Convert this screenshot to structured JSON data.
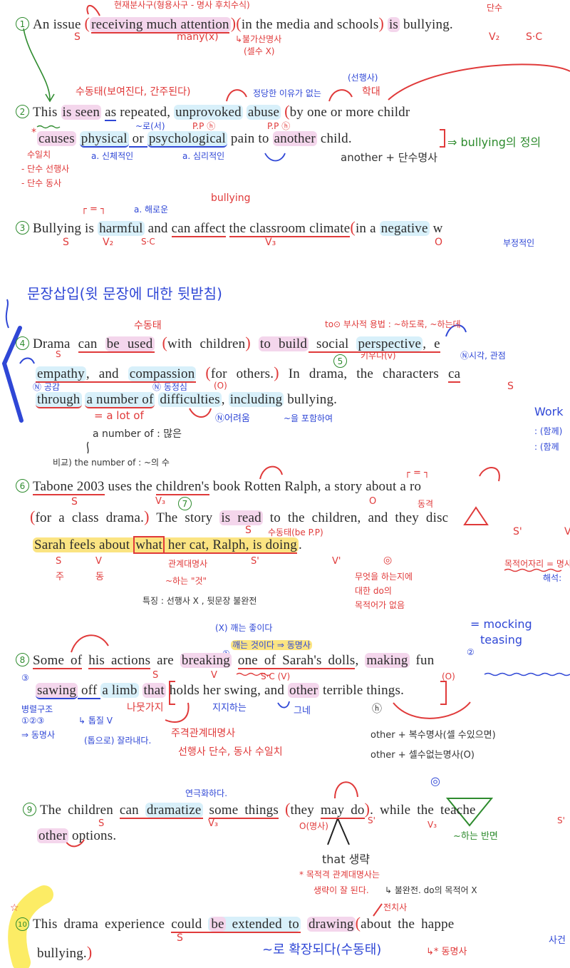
{
  "s1": {
    "num": "1",
    "t1": "An issue ",
    "t2": "receiving much attention",
    "t3": "in the media and schools",
    "t4": "is",
    "t5": " bullying.",
    "notes": {
      "top": "현재분사구(형용사구 - 명사 후치수식)",
      "s": "S",
      "many": "many(x)",
      "uncount": "↳불가산명사",
      "uncount2": "(셀수 X)",
      "sing": "단수",
      "v2": "V₂",
      "sc": "S·C"
    }
  },
  "s2": {
    "num": "2",
    "l1": {
      "t1": "This",
      "t2": "is seen",
      "t3": "as",
      "t4": " repeated, ",
      "t5": "unprovoked",
      "t6": "abuse",
      "t7": "by one or more childr"
    },
    "l2": {
      "t1": "causes",
      "t2": "physical",
      "t3": " or ",
      "t4": "psychological",
      "t5": " pain to ",
      "t6": "another",
      "t7": " child."
    },
    "notes": {
      "passive": "수동태(보여진다, 간주된다)",
      "unjust": "정당한 이유가 없는",
      "antecedent": "(선행사)",
      "abuse": "학대",
      "as": "~로(서)",
      "pp1": "P.P ⓗ",
      "pp2": "P.P ⓗ",
      "phys": "a. 신체적인",
      "psych": "a. 심리적인",
      "another": "another + 단수명사",
      "agree": "수일치",
      "sing_ante": "- 단수 선행사",
      "sing_verb": "- 단수 동사",
      "def": "⇒ bullying의 정의",
      "star": "*"
    }
  },
  "s3": {
    "num": "3",
    "t1": "Bullying",
    "t2": " is ",
    "t3": "harmful",
    "t4": " and ",
    "t5": "can affect",
    "t6": "the classroom climate",
    "t7": "in a ",
    "t8": "negative",
    "t9": " w",
    "notes": {
      "harmful": "a. 해로운",
      "eq": "┌ = ┐",
      "bullying": "bullying",
      "s": "S",
      "v2": "V₂",
      "sc": "S·C",
      "v3": "V₃",
      "o": "O",
      "negative": "부정적인"
    }
  },
  "section_heading": "문장삽입(윗 문장에 대한 뒷받침)",
  "s4": {
    "num": "4",
    "l1": {
      "t1": "Drama ",
      "t2": "can ",
      "t3": "be used",
      "t4": "with children",
      "t5": "to build",
      "t6": " social ",
      "t7": "perspective",
      "t8": ", e"
    },
    "l2": {
      "t1": "empathy",
      "t2": ", and ",
      "t3": "compassion",
      "t4": "for others.",
      "t5": " In drama, the characters ",
      "t6": "ca"
    },
    "l3": {
      "t1": "through",
      "t2": "a number of",
      "t3": "difficulties",
      "t4": ", ",
      "t5": "including",
      "t6": " bullying."
    },
    "notes": {
      "passive": "수동태",
      "to_v": "to⊙ 부사적 용법 : ~하도록, ~하는데",
      "build": "키우다(v)",
      "persp": "Ⓝ시각, 관점",
      "s": "S",
      "empathy": "Ⓝ 공감",
      "compassion": "Ⓝ 동정심",
      "o": "(O)",
      "s2": "S",
      "lot": "= a lot of",
      "diff": "Ⓝ어려움",
      "incl": "~을 포함하여",
      "anum": "a number of : 많은",
      "cmp": "비교) the number of : ~의 수",
      "num5": "5"
    },
    "side": {
      "work": "Work",
      "w1": ": (함께)",
      "w2": ": (함께"
    }
  },
  "s6": {
    "num": "6",
    "l1": {
      "t1": "Tabone 2003",
      "t2": " uses the ",
      "t3": "children's",
      "t4": " book Rotten Ralph",
      "t5": ", a story ",
      "t6": "about a ro"
    },
    "l2": {
      "t1": "for a class drama.",
      "t2": " The story ",
      "t3": "is read",
      "t4": " to the children, ",
      "t5": "and",
      "t6": " they disc"
    },
    "l3": {
      "t1": "Sarah feels about ",
      "t2": "what",
      "t3": " her cat, Ralph, is doing",
      "t4": "."
    },
    "notes": {
      "s": "S",
      "v3": "V₃",
      "o": "O",
      "eq": "┌ = ┐",
      "appos": "동격",
      "num7": "7",
      "s7": "S",
      "passive": "수동태(be P.P)",
      "s_prime": "S'",
      "v_prime": "V",
      "s_ju": "S",
      "ju": "주",
      "v_dong": "V",
      "dong": "동",
      "relpron": "관계대명사",
      "thing": "~하는 \"것\"",
      "feature": "특징 : 선행사 X , 뒷문장 불완전",
      "s3": "S'",
      "v3b": "V'",
      "circ": "◎",
      "missing1": "무엇을 하는지에",
      "missing2": "대한 do의",
      "missing3": "목적어가 없음",
      "objpos": "목적어자리 = 명사절",
      "interp": "해석:"
    }
  },
  "s8": {
    "num": "8",
    "l1": {
      "t1": "Some of",
      "t2": "his actions",
      "t3": " are ",
      "t4": "breaking",
      "t5": " ",
      "t6": "one of Sarah's dolls",
      "t7": ", ",
      "t8": "making",
      "t9": " fun"
    },
    "l2": {
      "t1": "sawing",
      "t2": " off ",
      "t3": "a limb",
      "t4": "that",
      "t5": " ",
      "t6": "holds",
      "t7": " her swing",
      "t8": ", and ",
      "t9": "other",
      "t10": " terrible things."
    },
    "notes": {
      "wrong": "(X) 깨는 좋이다",
      "right": "깨는 것이다 ⇒ 동명사",
      "c1": "①",
      "c2": "②",
      "c3": "③",
      "mocking": "= mocking",
      "teasing": "teasing",
      "s": "S",
      "v": "V",
      "sc": "S·C (V)",
      "o": "(O)",
      "branch": "나뭇가지",
      "support": "지지하는",
      "swing": "그네",
      "adj": "ⓗ",
      "parallel": "병렬구조",
      "p123": "①②③",
      "gerund": "⇒ 동명사",
      "saw": "↳ 톱질 V",
      "cut": "(톱으로) 잘라내다.",
      "subjrel": "주격관계대명사",
      "agree": "선행사 단수, 동사 수일치",
      "other_pl": "other + 복수명사(셀 수있으면)",
      "other_unc": "other + 셀수없는명사(O)"
    }
  },
  "s9": {
    "num": "9",
    "l1": {
      "t1": "The children ",
      "t2": "can ",
      "t3": "dramatize",
      "t4": " ",
      "t5": "some things",
      "t6": "they",
      "t7": " ",
      "t8": "may do",
      "t9": ". ",
      "t10": "while",
      "t11": " the teache"
    },
    "l2": {
      "t1": "other",
      "t2": " options."
    },
    "notes": {
      "dramatize": "연극화하다.",
      "s": "S",
      "v3": "V₃",
      "o": "O(명사)",
      "s_prime": "S'",
      "v3b": "V₃",
      "s3": "S'",
      "target": "◎",
      "while": "~하는 반면",
      "that_omit": "that 생략",
      "obj1": "* 목적격 관계대명사는",
      "obj2": "생략이 잘 된다.",
      "incomplete": "↳ 불완전. do의 목적어 X"
    }
  },
  "s10": {
    "num": "10",
    "l1": {
      "t1": "This drama experience ",
      "t2": "could ",
      "t3": "be",
      "t4": " ",
      "t5": "extended",
      "t6": " to",
      "t7": " ",
      "t8": "drawing",
      "t9": "about the happe"
    },
    "l2": {
      "t1": "bullying."
    },
    "notes": {
      "prep": "전치사",
      "s": "S",
      "ext": "~로 확장되다(수동태)",
      "gerund": "↳* 동명사",
      "side": "사건",
      "star": "☆"
    }
  }
}
